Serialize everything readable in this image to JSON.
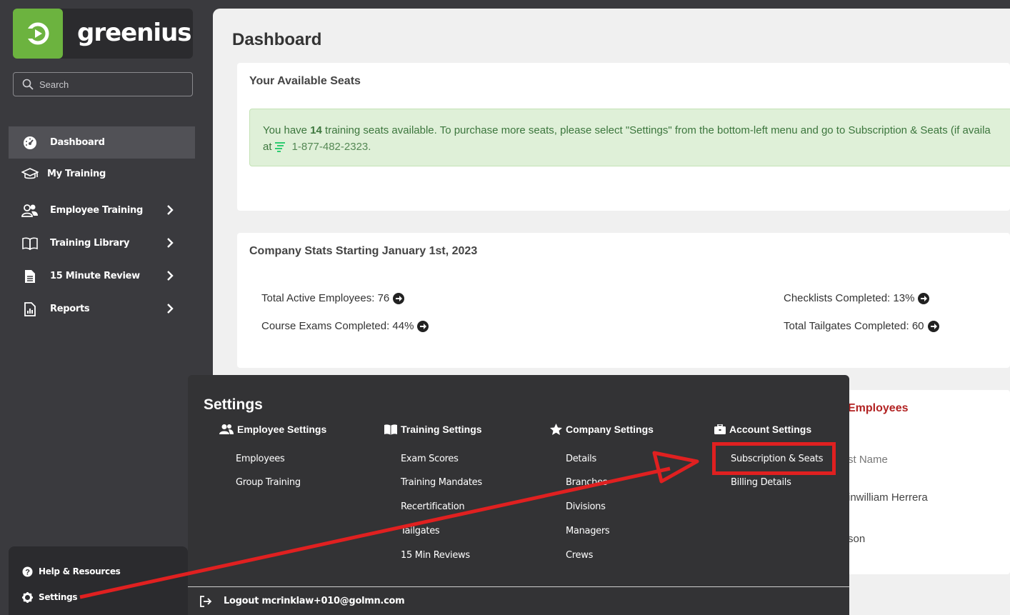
{
  "brand": {
    "name": "greenius",
    "accent": "#6cb33f"
  },
  "search": {
    "placeholder": "Search"
  },
  "sidebar": {
    "items": [
      {
        "label": "Dashboard",
        "icon": "speedometer-icon",
        "active": true
      },
      {
        "label": "My Training",
        "icon": "graduation-cap-icon"
      },
      {
        "label": "Employee Training",
        "icon": "users-icon",
        "has_submenu": true
      },
      {
        "label": "Training Library",
        "icon": "book-icon",
        "has_submenu": true
      },
      {
        "label": "15 Minute Review",
        "icon": "document-icon",
        "has_submenu": true
      },
      {
        "label": "Reports",
        "icon": "report-icon",
        "has_submenu": true
      }
    ],
    "bottom": [
      {
        "label": "Help & Resources",
        "icon": "question-circle-icon"
      },
      {
        "label": "Settings",
        "icon": "gear-icon"
      }
    ]
  },
  "main": {
    "title": "Dashboard",
    "seats_card": {
      "title": "Your Available Seats",
      "alert_pre": "You have ",
      "seat_count": "14",
      "alert_post": " training seats available. To purchase more seats, please select \"Settings\" from the bottom-left menu and go to Subscription & Seats (if availa",
      "alert_line2_pre": "at ",
      "phone": "1-877-482-2323."
    },
    "stats_card": {
      "title": "Company Stats Starting January 1st, 2023",
      "stats": [
        "Total Active Employees: 76",
        "Course Exams Completed: 44%",
        "Checklists Completed: 13%",
        "Total Tailgates Completed: 60"
      ]
    },
    "employees_card": {
      "title": "Employees",
      "col_header": "st Name",
      "rows": [
        "inwilliam Herrera",
        "son"
      ]
    }
  },
  "settings": {
    "title": "Settings",
    "columns": [
      {
        "heading": "Employee Settings",
        "icon": "users-icon",
        "links": [
          "Employees",
          "Group Training"
        ]
      },
      {
        "heading": "Training Settings",
        "icon": "open-book-icon",
        "links": [
          "Exam Scores",
          "Training Mandates",
          "Recertification",
          "Tailgates",
          "15 Min Reviews"
        ]
      },
      {
        "heading": "Company Settings",
        "icon": "star-icon",
        "links": [
          "Details",
          "Branches",
          "Divisions",
          "Managers",
          "Crews"
        ]
      },
      {
        "heading": "Account Settings",
        "icon": "briefcase-icon",
        "links": [
          "Subscription & Seats",
          "Billing Details"
        ]
      }
    ],
    "logout": "Logout mcrinklaw+010@golmn.com"
  },
  "annotation_color": "#e02020"
}
